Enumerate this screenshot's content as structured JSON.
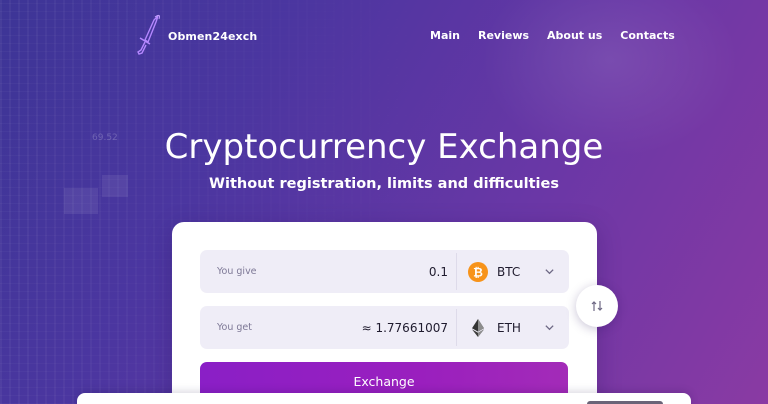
{
  "header": {
    "logo_text": "Obmen24exch",
    "nav": [
      "Main",
      "Reviews",
      "About us",
      "Contacts"
    ]
  },
  "hero": {
    "title": "Cryptocurrency Exchange",
    "subtitle": "Without registration, limits and difficulties"
  },
  "exchange": {
    "give": {
      "label": "You give",
      "amount": "0.1",
      "currency": "BTC",
      "icon": "bitcoin-icon",
      "color": "#f7931a"
    },
    "get": {
      "label": "You get",
      "amount": "≈ 1.77661007",
      "currency": "ETH",
      "icon": "ethereum-icon",
      "color": "#343434"
    },
    "button_label": "Exchange",
    "swap_icon": "swap-arrows-icon"
  },
  "background_numbers": [
    "69.52"
  ],
  "colors": {
    "accent": "#9a1fbe",
    "background_start": "#3d3596",
    "background_end": "#8a3aa3",
    "field_bg": "#efedf7"
  }
}
